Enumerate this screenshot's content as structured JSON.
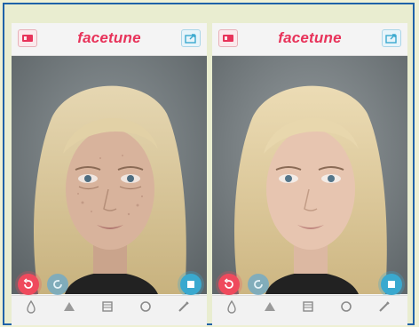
{
  "app": {
    "logo_text": "facetune"
  },
  "panels": [
    {
      "id": "before",
      "state": "original"
    },
    {
      "id": "after",
      "state": "retouched"
    }
  ],
  "toolbar": {
    "tool_icons": [
      "smooth-drop-icon",
      "whiten-triangle-icon",
      "details-square-icon",
      "refine-circle-icon",
      "patch-brush-icon"
    ]
  },
  "colors": {
    "accent": "#e8335a",
    "undo": "#ef4a5d",
    "compare": "#3aa9cf",
    "frame_border": "#1f62a8",
    "background": "#eef0d4"
  }
}
